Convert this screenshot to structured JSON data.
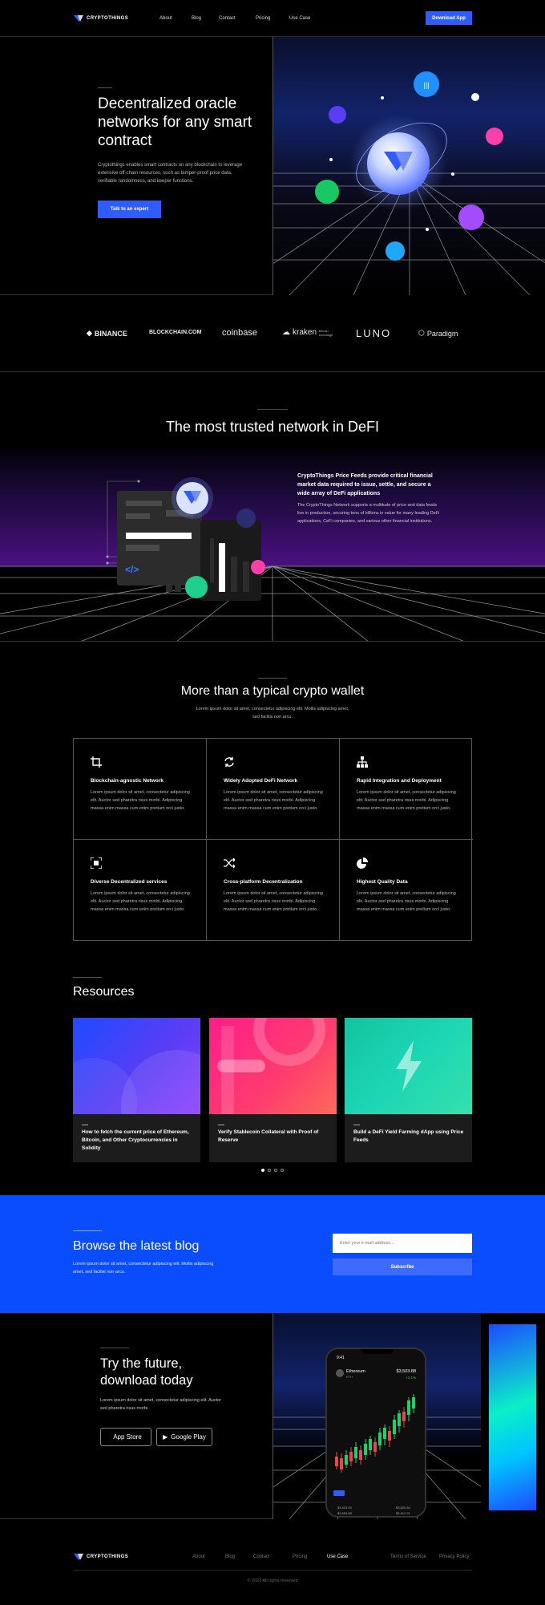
{
  "nav": {
    "brand": "CRYPTOTHINGS",
    "links": [
      "About",
      "Blog",
      "Contact",
      "Pricing",
      "Use Case"
    ],
    "cta": "Download App"
  },
  "hero": {
    "title": "Decentralized oracle networks for any smart contract",
    "description": "Cryptothings enables smart contracts on any blockchain to leverage extensive off-chain resources, such as tamper-proof price data, verifiable randomness, and keeper functions.",
    "cta": "Talk to an expert"
  },
  "partners": [
    "BINANCE",
    "BLOCKCHAIN.COM",
    "coinbase",
    "kraken",
    "LUNO",
    "Paradigm"
  ],
  "partners_sub": {
    "kraken": "bitcoin exchange"
  },
  "trusted": {
    "title": "The most trusted network in DeFI",
    "lead": "CryptoThings Price Feeds provide critical financial market data required to issue, settle, and secure a wide array of DeFi applications",
    "body": "The CryptoThings Network supports a multitude of price and data feeds live in production, securing tens of billions in value for many leading DeFi applications, CeFi companies, and various other financial institutions."
  },
  "features": {
    "title": "More than a typical crypto wallet",
    "subtitle": "Lorem ipsum dolor sit amet, consectetur adipiscing elit. Mollis adipiscing amet, sed facilisi non arcu.",
    "items": [
      {
        "title": "Blockchain-agnostic Network",
        "text": "Lorem ipsum dolor sit amet, consectetur adipiscing elit. Auctor sed pharetra risus morbi. Adipiscing massa enim massa cum enim pretium orci justo.",
        "icon": "crop-icon"
      },
      {
        "title": "Widely Adopted DeFi Network",
        "text": "Lorem ipsum dolor sit amet, consectetur adipiscing elit. Auctor sed pharetra risus morbi. Adipiscing massa enim massa cum enim pretium orci justo.",
        "icon": "refresh-icon"
      },
      {
        "title": "Rapid Integration and Deployment",
        "text": "Lorem ipsum dolor sit amet, consectetur adipiscing elit. Auctor sed pharetra risus morbi. Adipiscing massa enim massa cum enim pretium orci justo.",
        "icon": "hierarchy-icon"
      },
      {
        "title": "Diverse Decentralized services",
        "text": "Lorem ipsum dolor sit amet, consectetur adipiscing elit. Auctor sed pharetra risus morbi. Adipiscing massa enim massa cum enim pretium orci justo.",
        "icon": "focus-icon"
      },
      {
        "title": "Cross-platform Decentralization",
        "text": "Lorem ipsum dolor sit amet, consectetur adipiscing elit. Auctor sed pharetra risus morbi. Adipiscing massa enim massa cum enim pretium orci justo.",
        "icon": "shuffle-icon"
      },
      {
        "title": "Highest Quality Data",
        "text": "Lorem ipsum dolor sit amet, consectetur adipiscing elit. Auctor sed pharetra risus morbi. Adipiscing massa enim massa cum enim pretium orci justo.",
        "icon": "pie-chart-icon"
      }
    ]
  },
  "resources": {
    "title": "Resources",
    "cards": [
      {
        "title": "How to fetch the current price of Ethereum, Bitcoin, and Other Cryptocurrencies in Solidity"
      },
      {
        "title": "Verify Stablecoin Collateral with Proof of Reserve"
      },
      {
        "title": "Build a DeFi Yield Farming dApp using Price Feeds"
      }
    ]
  },
  "blog": {
    "title": "Browse the latest blog",
    "subtitle": "Lorem ipsum dolor sit amet, consectetur adipiscing elit. Mollis adipiscing amet, sed facilisi non arcu.",
    "email_placeholder": "Enter your e-mail address...",
    "subscribe": "Subscribe"
  },
  "download": {
    "title": "Try the future, download today",
    "subtitle": "Lorem ipsum dolor sit amet, consectetur adipiscing elit. Auctor sed pharetra risus morbi.",
    "app_store": "App Store",
    "google_play": "Google Play",
    "phone": {
      "time": "9:41",
      "coin": "Ethereum",
      "ticker": "ETH",
      "price": "$3,503.88",
      "change": "+1.1%",
      "stats": [
        "$3,423.20",
        "$3,554.88",
        "$3,520.84",
        "$3,412.21"
      ]
    }
  },
  "footer": {
    "brand": "CRYPTOTHINGS",
    "links": [
      "About",
      "Blog",
      "Contact",
      "Pricing",
      "Use Case"
    ],
    "legal": [
      "Terms of Service",
      "Privacy Policy"
    ],
    "copyright": "© 2021 All rights reserved"
  },
  "colors": {
    "accent": "#2f5cff",
    "blog_bg": "#0a4cff"
  }
}
